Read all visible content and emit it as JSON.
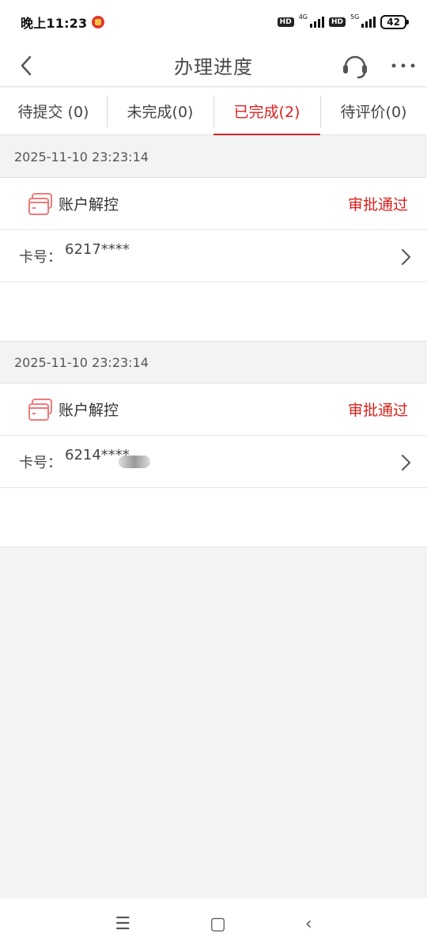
{
  "status": {
    "time": "晚上11:23",
    "network1": "4G",
    "network2": "5G",
    "hd": "HD",
    "battery": "42"
  },
  "nav": {
    "title": "办理进度"
  },
  "tabs": [
    {
      "label": "待提交 (0)",
      "active": false
    },
    {
      "label": "未完成(0)",
      "active": false
    },
    {
      "label": "已完成(2)",
      "active": true
    },
    {
      "label": "待评价(0)",
      "active": false
    }
  ],
  "records": [
    {
      "date": "2025-11-10 23:23:14",
      "service": "账户解控",
      "state": "审批通过",
      "card_label": "卡号：",
      "card_number": "6217****"
    },
    {
      "date": "2025-11-10 23:23:14",
      "service": "账户解控",
      "state": "审批通过",
      "card_label": "卡号：",
      "card_number": "6214****"
    }
  ],
  "colors": {
    "accent": "#e02020",
    "icon": "#f07a7a"
  }
}
